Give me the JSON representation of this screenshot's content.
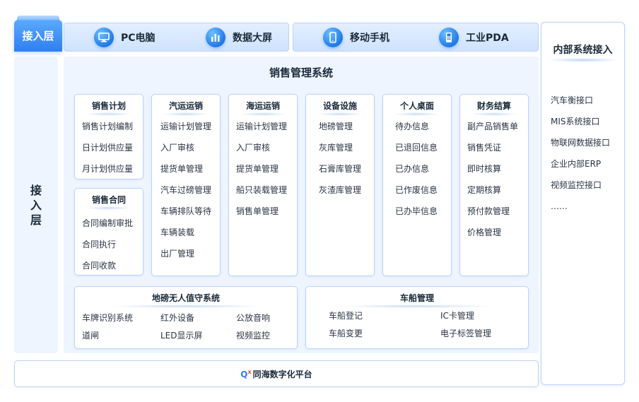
{
  "access_tab": {
    "label": "接入层"
  },
  "access_bar": {
    "items": [
      {
        "label": "PC电脑",
        "icon": "monitor-icon"
      },
      {
        "label": "数据大屏",
        "icon": "bar-chart-icon"
      },
      {
        "label": "移动手机",
        "icon": "mobile-phone-icon"
      },
      {
        "label": "工业PDA",
        "icon": "handheld-device-icon"
      }
    ]
  },
  "left_column": {
    "label": "接入层"
  },
  "main": {
    "title": "销售管理系统",
    "modules": [
      {
        "title": "销售计划",
        "items": [
          "销售计划编制",
          "日计划供应量",
          "月计划供应量"
        ]
      },
      {
        "title": "销售合同",
        "items": [
          "合同编制审批",
          "合同执行",
          "合同收款"
        ]
      },
      {
        "title": "汽运运销",
        "items": [
          "运输计划管理",
          "入厂审核",
          "提货单管理",
          "汽车过磅管理",
          "车辆排队等待",
          "车辆装载",
          "出厂管理"
        ]
      },
      {
        "title": "海运运销",
        "items": [
          "运输计划管理",
          "入厂审核",
          "提货单管理",
          "船只装载管理",
          "销售单管理"
        ]
      },
      {
        "title": "设备设施",
        "items": [
          "地磅管理",
          "灰库管理",
          "石膏库管理",
          "灰渣库管理"
        ]
      },
      {
        "title": "个人桌面",
        "items": [
          "待办信息",
          "已退回信息",
          "已办信息",
          "已作废信息",
          "已办毕信息"
        ]
      },
      {
        "title": "财务结算",
        "items": [
          "副产品销售单",
          "销售凭证",
          "即时核算",
          "定期核算",
          "预付款管理",
          "价格管理"
        ]
      }
    ],
    "weighbridge": {
      "title": "地磅无人值守系统",
      "items": [
        "车牌识别系统",
        "红外设备",
        "公放音响",
        "道闸",
        "LED显示屏",
        "视频监控"
      ]
    },
    "vehicle_ship": {
      "title": "车船管理",
      "items": [
        "车船登记",
        "IC卡管理",
        "车船变更",
        "电子标签管理"
      ]
    }
  },
  "right_column": {
    "title": "内部系统接入",
    "items": [
      "汽车衡接口",
      "MIS系统接口",
      "物联网数据接口",
      "企业内部ERP",
      "视频监控接口",
      "……"
    ]
  },
  "footer": {
    "logo_text": "Q",
    "logo_mark": "x",
    "label": "同海数字化平台"
  },
  "colors": {
    "accent": "#2f7ff0",
    "panel_bg": "#eef5ff",
    "border": "#b9d3fb"
  }
}
